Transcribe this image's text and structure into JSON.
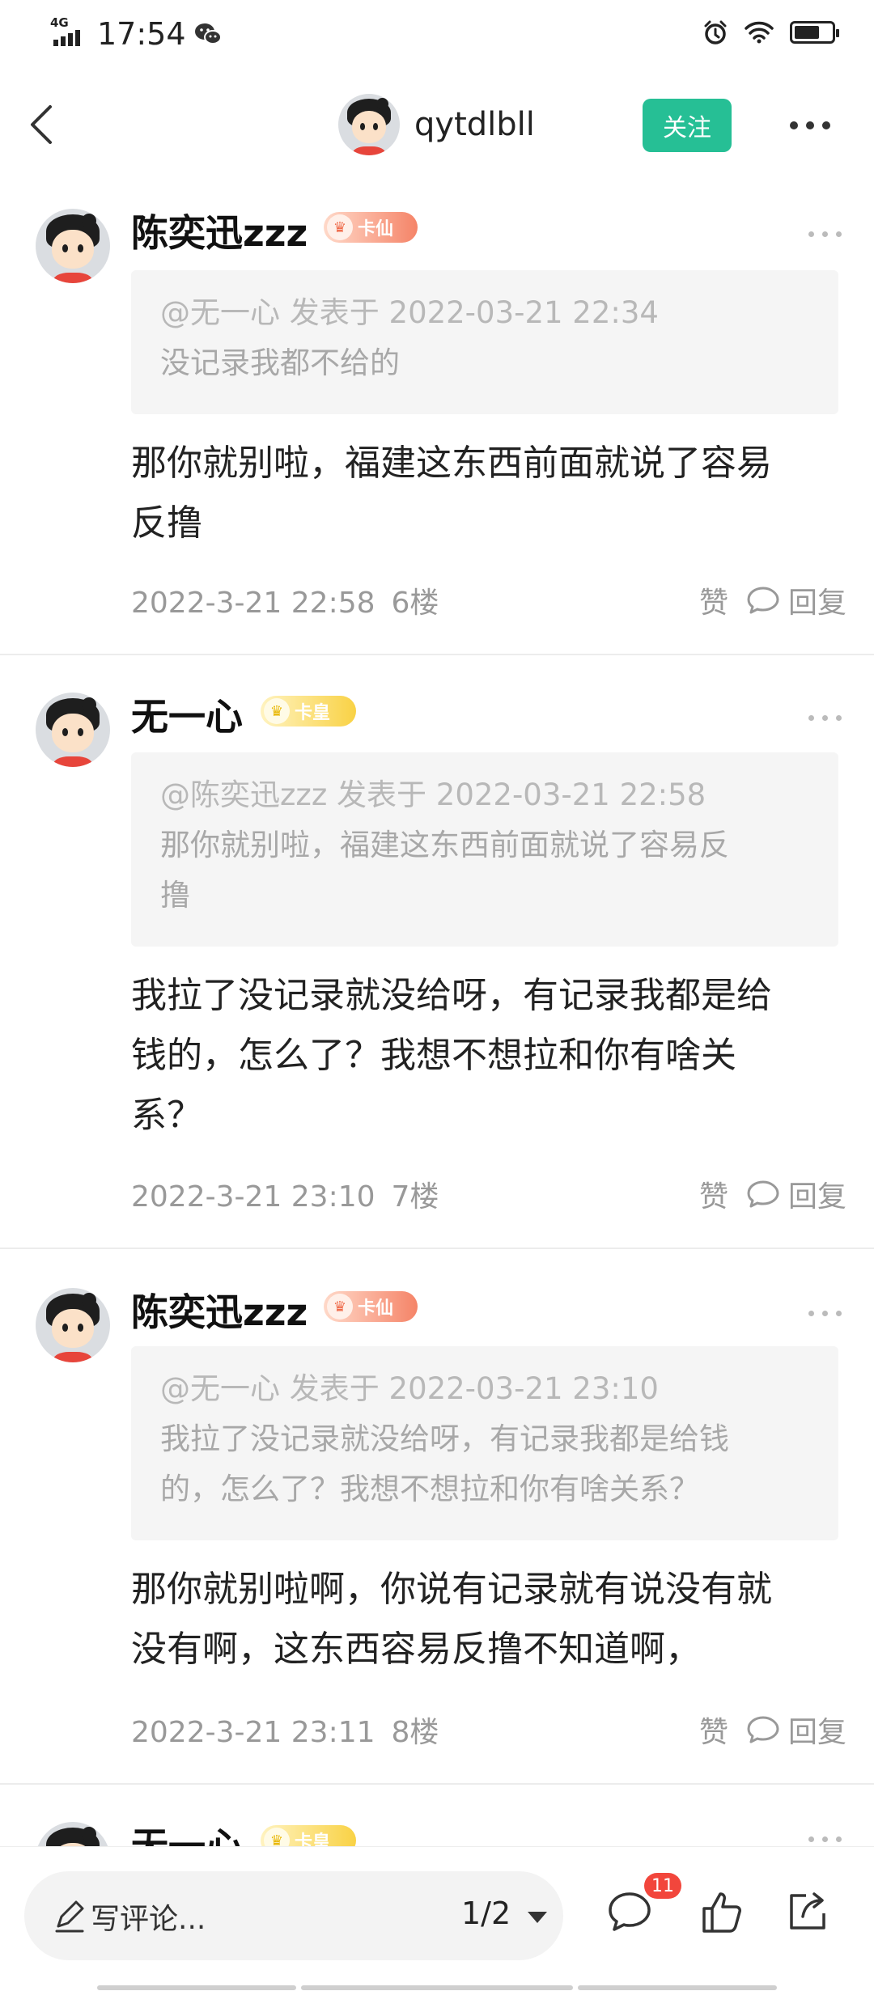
{
  "status_bar": {
    "time": "17:54",
    "network": "4G"
  },
  "header": {
    "username": "qytdlbll",
    "follow_label": "关注"
  },
  "comments": [
    {
      "name": "陈奕迅zzz",
      "badge": "卡仙",
      "badge_style": "xian",
      "quote_header": "@无一心 发表于 2022-03-21 22:34",
      "quote_lines": [
        "没记录我都不给的"
      ],
      "text_lines": [
        "那你就别啦，福建这东西前面就说了容易",
        "反撸"
      ],
      "time": "2022-3-21 22:58",
      "floor": "6楼",
      "like_label": "赞",
      "reply_label": "回复"
    },
    {
      "name": "无一心",
      "badge": "卡皇",
      "badge_style": "huang",
      "quote_header": "@陈奕迅zzz 发表于 2022-03-21 22:58",
      "quote_lines": [
        "那你就别啦，福建这东西前面就说了容易反",
        "撸"
      ],
      "text_lines": [
        "我拉了没记录就没给呀，有记录我都是给",
        "钱的，怎么了？我想不想拉和你有啥关",
        "系？"
      ],
      "time": "2022-3-21 23:10",
      "floor": "7楼",
      "like_label": "赞",
      "reply_label": "回复"
    },
    {
      "name": "陈奕迅zzz",
      "badge": "卡仙",
      "badge_style": "xian",
      "quote_header": "@无一心 发表于 2022-03-21 23:10",
      "quote_lines": [
        "我拉了没记录就没给呀，有记录我都是给钱",
        "的，怎么了？我想不想拉和你有啥关系？"
      ],
      "text_lines": [
        "那你就别啦啊，你说有记录就有说没有就",
        "没有啊，这东西容易反撸不知道啊，"
      ],
      "time": "2022-3-21 23:11",
      "floor": "8楼",
      "like_label": "赞",
      "reply_label": "回复"
    },
    {
      "name": "无一心",
      "badge": "卡皇",
      "badge_style": "huang"
    }
  ],
  "bottom_bar": {
    "placeholder": "写评论...",
    "page_indicator": "1/2",
    "notification_count": "11"
  },
  "colors": {
    "accent": "#26bf95",
    "notification": "#f2463c"
  }
}
